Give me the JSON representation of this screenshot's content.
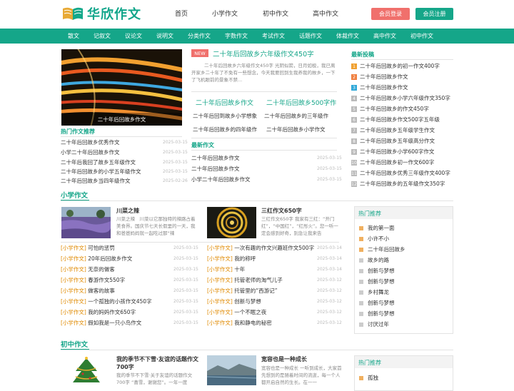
{
  "header": {
    "logo_text": "华欣作文",
    "top_nav": [
      "首页",
      "小学作文",
      "初中作文",
      "高中作文"
    ],
    "login": "会员登录",
    "register": "会员注册"
  },
  "navbar": [
    "散文",
    "记叙文",
    "议论文",
    "说明文",
    "分类作文",
    "字数作文",
    "考试作文",
    "话题作文",
    "体裁作文",
    "高中作文",
    "初中作文"
  ],
  "featured": {
    "image_caption": "二十年后回故乡作文",
    "new_badge": "NEW",
    "headline": "二十年后回故乡六年级作文450字",
    "summary": "二十年后回故乡六年级作文450字 光阴似箭，日月如梭，我已离开家乡二十年了不免有一些想念，今天我要回到生我养我的故乡，一下了飞机眼前的景象不禁...",
    "sub_headlines": [
      "二十年后回故乡作文",
      "二十年后回故乡500字作"
    ],
    "grid": [
      "二十年后回到故乡小学想象",
      "二十年后回故乡的三年级作",
      "二十年后回故乡的四年级作",
      "二十年后回故乡小学作文"
    ]
  },
  "hot_left": {
    "title": "热门作文推荐",
    "items": [
      {
        "t": "二十年后回故乡优秀作文",
        "d": "2025-03-15"
      },
      {
        "t": "小学二十年后回故乡作文",
        "d": "2025-03-15"
      },
      {
        "t": "二十年后我回了故乡五年级作文",
        "d": "2025-03-15"
      },
      {
        "t": "二十年后回故乡的小学五年级作文",
        "d": "2025-03-15"
      },
      {
        "t": "二十年后回故乡当四年级作文",
        "d": "2025-02-26"
      }
    ]
  },
  "latest_mid": {
    "title": "最新作文",
    "items": [
      {
        "t": "二十年后回故乡作文",
        "d": "2025-03-15"
      },
      {
        "t": "二十年后回故乡作文",
        "d": "2025-03-15"
      },
      {
        "t": "小学二十年后回故乡作文",
        "d": "2025-03-15"
      }
    ]
  },
  "latest_right": {
    "title": "最新投稿",
    "items": [
      "二十年后回故乡的初一作文400字",
      "二十年后回故乡作文",
      "二十年后回故乡作文",
      "二十年后回故乡小学六年级作文350字",
      "二十年后回故乡的作文450字",
      "二十年后回故乡作文500字五年级",
      "二十年后回故乡五年级学生作文",
      "二十年后回故乡五年级高分作文",
      "二十年后回故乡小学600字作文",
      "二十年后回故乡初一作文600字",
      "二十年后回故乡优秀三年级作文400字",
      "二十年后回故乡的五年级作文350字"
    ],
    "nums": [
      "1",
      "2",
      "3",
      "4",
      "5",
      "6",
      "7",
      "8",
      "9",
      "10",
      "11",
      "12"
    ]
  },
  "primary": {
    "title": "小学作文",
    "card1": {
      "title": "川菜之辣",
      "text": "川菜之辣　川菜以它那独特的辣路占着美食界。国庆节七天长假里的一天，我和爸爸妈妈就一起吃过那“辣"
    },
    "card2": {
      "title": "三红作文650字",
      "text": "三红作文650字 我家有三红：“开门红”，“中国红”，“红彤火”。您一听一定会感到好奇，别急让我来告"
    },
    "tag": "[小学作文]",
    "left_list": [
      {
        "t": "可怕的惩罚",
        "d": "2025-03-15"
      },
      {
        "t": "20年后回故乡作文",
        "d": "2025-03-15"
      },
      {
        "t": "无奈的做客",
        "d": "2025-03-15"
      },
      {
        "t": "春游作文550字",
        "d": "2025-03-15"
      },
      {
        "t": "做客的故事",
        "d": "2025-03-15"
      },
      {
        "t": "一个孤独的小孩作文450字",
        "d": "2025-03-15"
      },
      {
        "t": "我的妈妈作文650字",
        "d": "2025-03-15"
      },
      {
        "t": "假如我是一只小鸟作文",
        "d": "2025-03-15"
      }
    ],
    "right_list": [
      {
        "t": "一次有趣的作文兴趣班作文500字",
        "d": "2025-03-14"
      },
      {
        "t": "我的称呼",
        "d": "2025-03-14"
      },
      {
        "t": "十年",
        "d": "2025-03-14"
      },
      {
        "t": "托管老师的淘气儿子",
        "d": "2025-03-12"
      },
      {
        "t": "托管里的“西游记”",
        "d": "2025-03-12"
      },
      {
        "t": "创新与梦想",
        "d": "2025-03-12"
      },
      {
        "t": "一个不眠之夜",
        "d": "2025-03-12"
      },
      {
        "t": "我和静电的秘密",
        "d": "2025-03-12"
      }
    ]
  },
  "hot1": {
    "title": "热门推荐",
    "items": [
      "我的第一面",
      "小许不小",
      "二十年后回故乡",
      "故乡的路",
      "创新与梦想",
      "创新与梦想",
      "乡村舞龙",
      "创新与梦想",
      "创新与梦想",
      "讨厌过年"
    ]
  },
  "junior": {
    "title": "初中作文",
    "card1": {
      "title": "我的季节不下雪·友谊的话题作文700字",
      "text": "我的季节不下雪·关于友谊的话题作文700字 “喜雪，谢谢您”。一年一度"
    },
    "card2": {
      "title": "宽容也是一种成长",
      "text": "宽容也是一种成长 一听到成长，大家首先想到的是随着时间的流逝，每一个人都开启自然的生长。在一一"
    }
  },
  "hot2": {
    "title": "热门推荐",
    "items": [
      "孤独"
    ]
  }
}
